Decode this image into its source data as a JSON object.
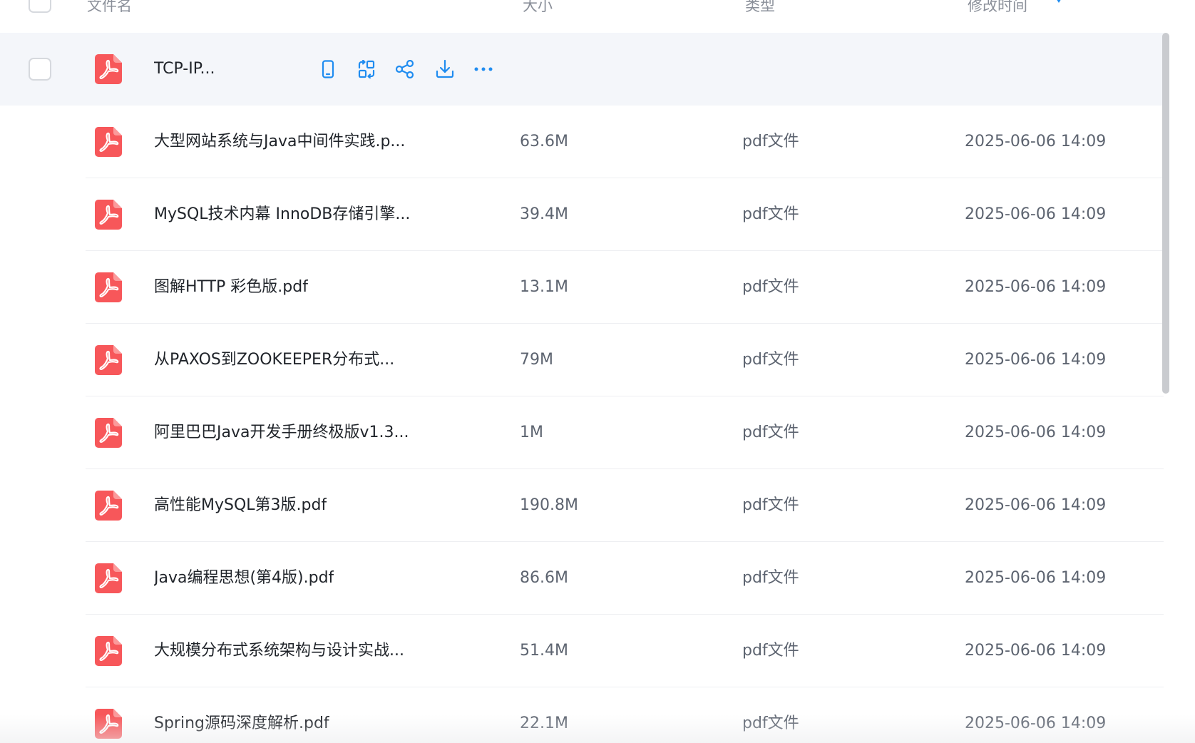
{
  "header": {
    "name": "文件名",
    "size": "大小",
    "type": "类型",
    "modified": "修改时间"
  },
  "colors": {
    "accent": "#1f8cf0",
    "pdf_icon": "#f7575a"
  },
  "rows": [
    {
      "name": "TCP-IP...",
      "size": "",
      "type": "",
      "modified": "",
      "hovered": true
    },
    {
      "name": "大型网站系统与Java中间件实践.p...",
      "size": "63.6M",
      "type": "pdf文件",
      "modified": "2025-06-06 14:09"
    },
    {
      "name": "MySQL技术内幕 InnoDB存储引擎...",
      "size": "39.4M",
      "type": "pdf文件",
      "modified": "2025-06-06 14:09"
    },
    {
      "name": "图解HTTP 彩色版.pdf",
      "size": "13.1M",
      "type": "pdf文件",
      "modified": "2025-06-06 14:09"
    },
    {
      "name": "从PAXOS到ZOOKEEPER分布式...",
      "size": "79M",
      "type": "pdf文件",
      "modified": "2025-06-06 14:09"
    },
    {
      "name": "阿里巴巴Java开发手册终极版v1.3...",
      "size": "1M",
      "type": "pdf文件",
      "modified": "2025-06-06 14:09"
    },
    {
      "name": "高性能MySQL第3版.pdf",
      "size": "190.8M",
      "type": "pdf文件",
      "modified": "2025-06-06 14:09"
    },
    {
      "name": "Java编程思想(第4版).pdf",
      "size": "86.6M",
      "type": "pdf文件",
      "modified": "2025-06-06 14:09"
    },
    {
      "name": "大规模分布式系统架构与设计实战...",
      "size": "51.4M",
      "type": "pdf文件",
      "modified": "2025-06-06 14:09"
    },
    {
      "name": "Spring源码深度解析.pdf",
      "size": "22.1M",
      "type": "pdf文件",
      "modified": "2025-06-06 14:09"
    }
  ],
  "row_actions": [
    {
      "icon": "phone-icon"
    },
    {
      "icon": "convert-icon"
    },
    {
      "icon": "share-icon"
    },
    {
      "icon": "download-icon"
    },
    {
      "icon": "more-icon"
    }
  ]
}
